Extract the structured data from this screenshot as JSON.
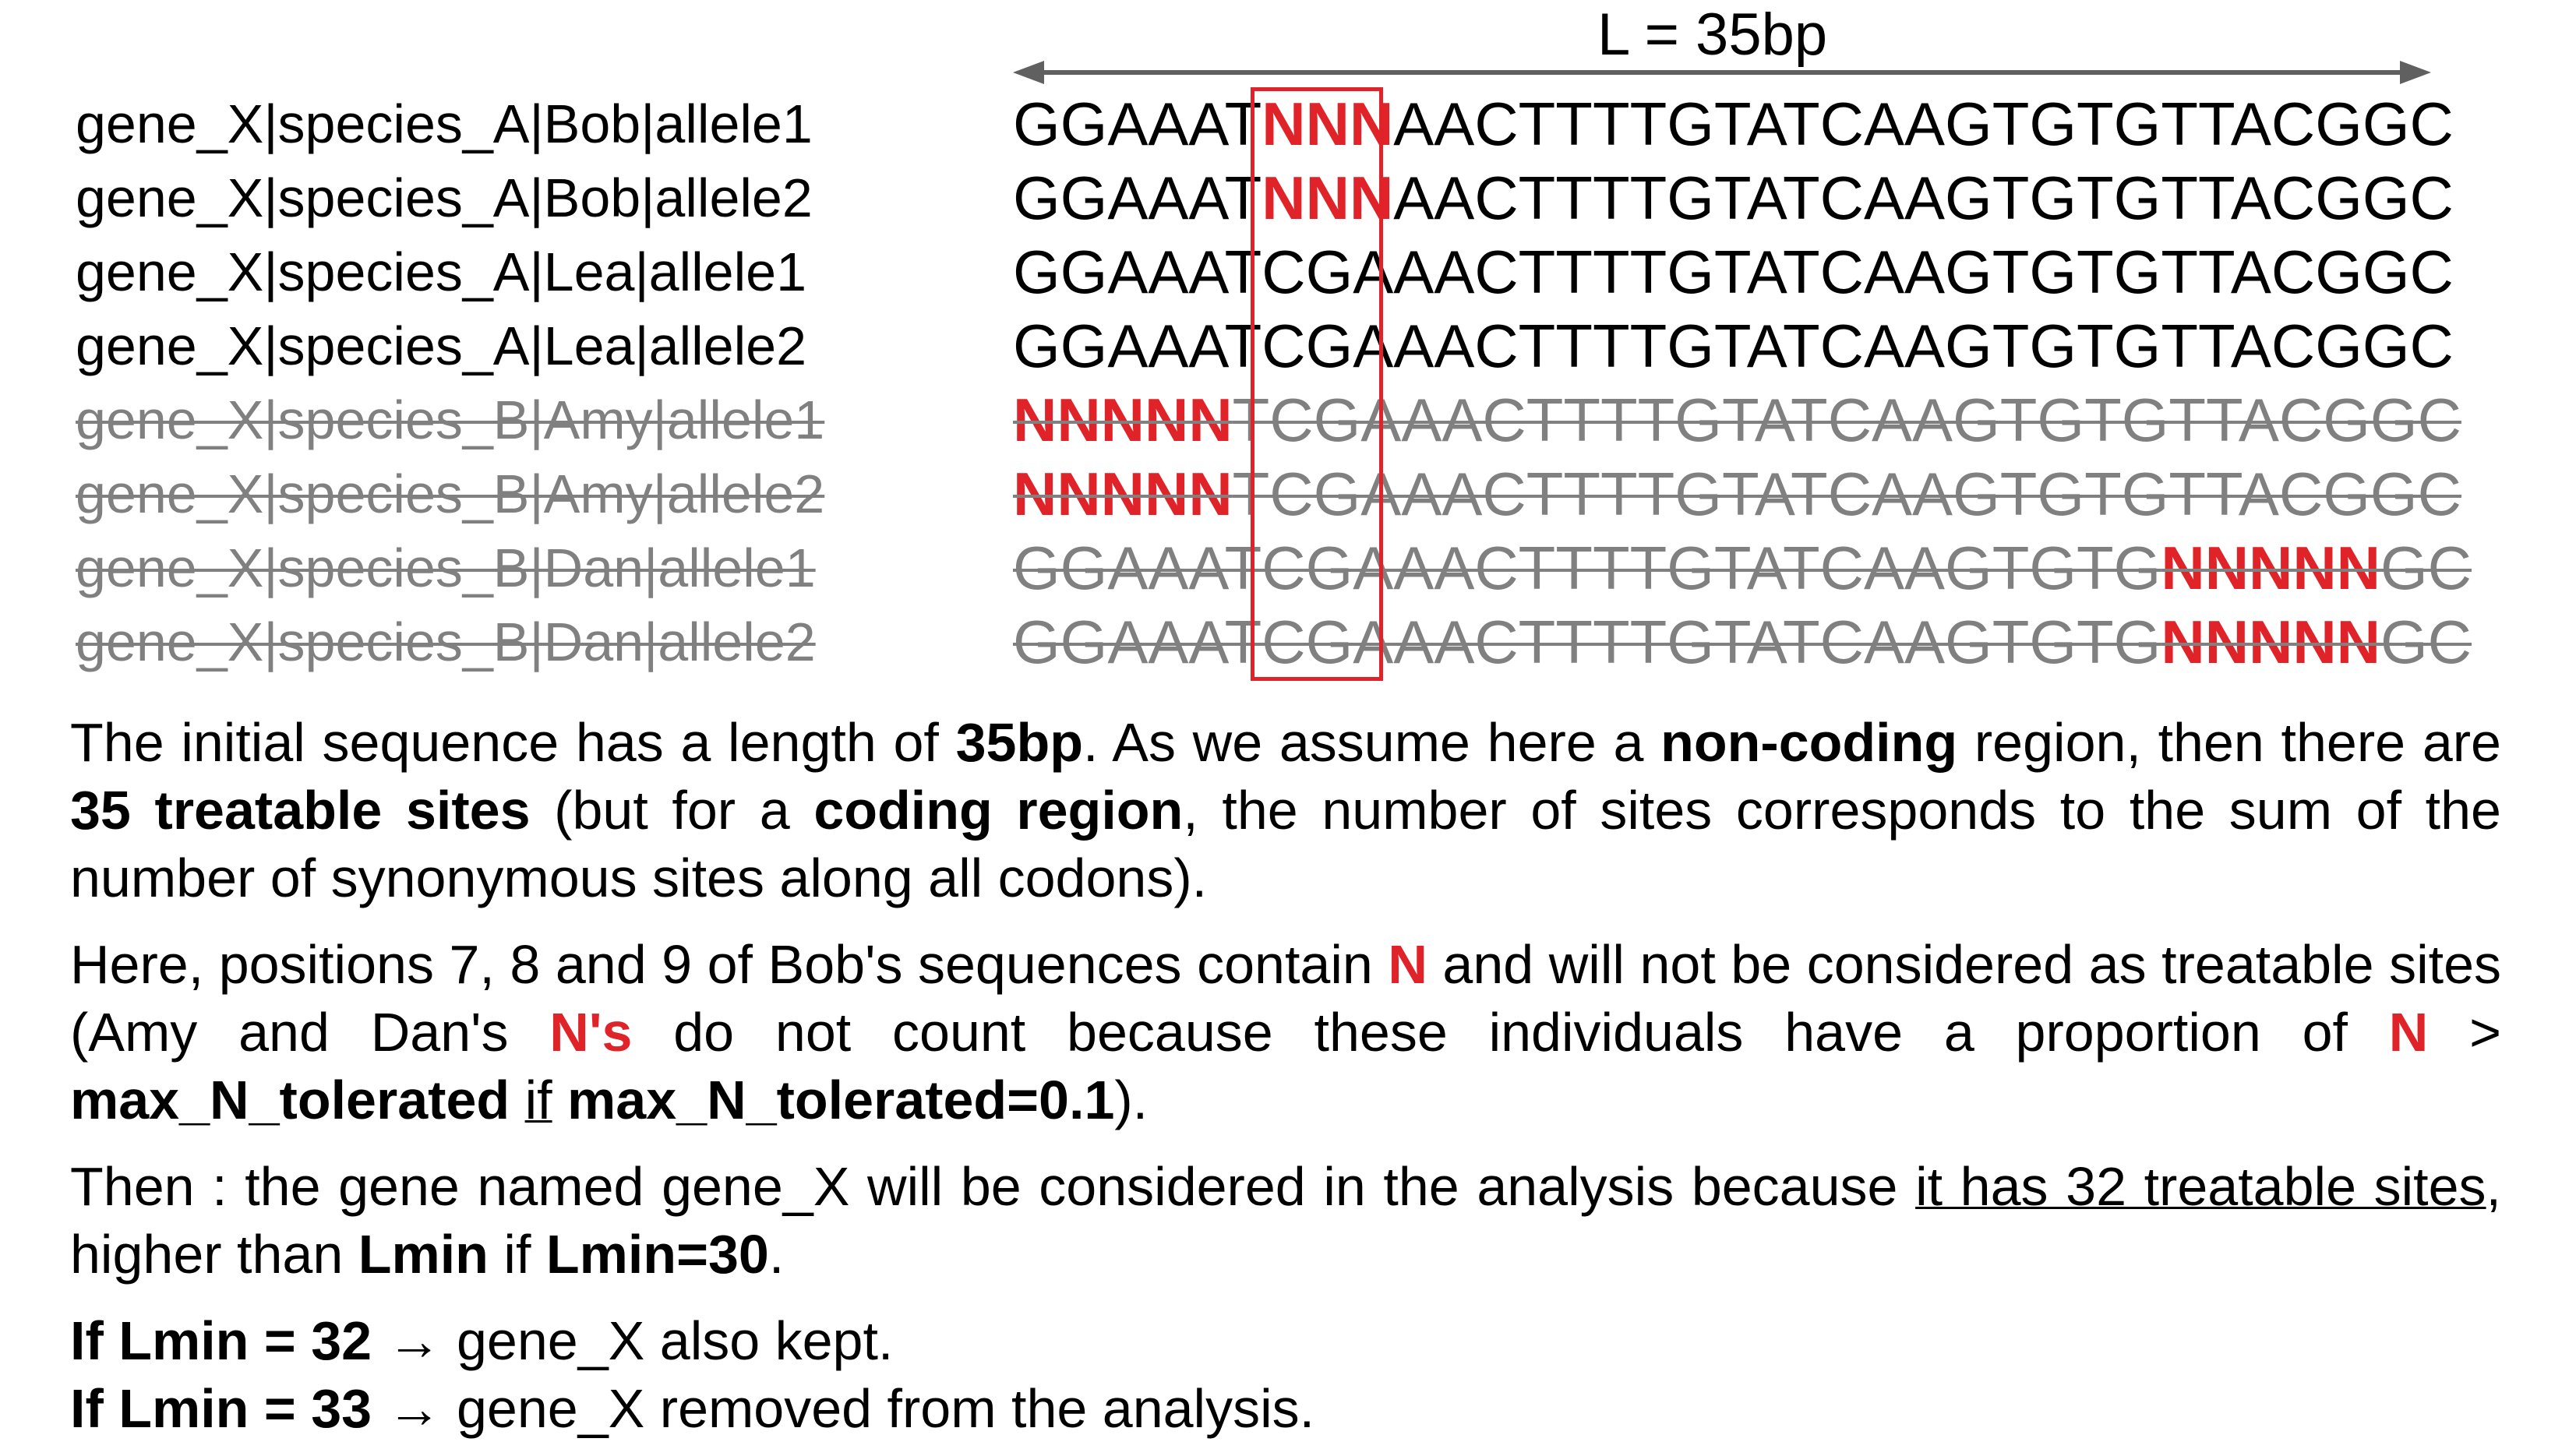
{
  "length_label": "L = 35bp",
  "gene_labels": [
    {
      "text": "gene_X|species_A|Bob|allele1",
      "excluded": false
    },
    {
      "text": "gene_X|species_A|Bob|allele2",
      "excluded": false
    },
    {
      "text": "gene_X|species_A|Lea|allele1",
      "excluded": false
    },
    {
      "text": "gene_X|species_A|Lea|allele2",
      "excluded": false
    },
    {
      "text": "gene_X|species_B|Amy|allele1",
      "excluded": true
    },
    {
      "text": "gene_X|species_B|Amy|allele2",
      "excluded": true
    },
    {
      "text": "gene_X|species_B|Dan|allele1",
      "excluded": true
    },
    {
      "text": "gene_X|species_B|Dan|allele2",
      "excluded": true
    }
  ],
  "sequences": [
    {
      "excluded": false,
      "segments": [
        {
          "text": "GGAAAT",
          "n": false
        },
        {
          "text": "NNN",
          "n": true
        },
        {
          "text": "AACTTTTGTATCAAGTGTGTTACGGC",
          "n": false
        }
      ]
    },
    {
      "excluded": false,
      "segments": [
        {
          "text": "GGAAAT",
          "n": false
        },
        {
          "text": "NNN",
          "n": true
        },
        {
          "text": "AACTTTTGTATCAAGTGTGTTACGGC",
          "n": false
        }
      ]
    },
    {
      "excluded": false,
      "segments": [
        {
          "text": "GGAAATCGAAACTTTTGTATCAAGTGTGTTACGGC",
          "n": false
        }
      ]
    },
    {
      "excluded": false,
      "segments": [
        {
          "text": "GGAAATCGAAACTTTTGTATCAAGTGTGTTACGGC",
          "n": false
        }
      ]
    },
    {
      "excluded": true,
      "segments": [
        {
          "text": "NNNNN",
          "n": true
        },
        {
          "text": "TCGAAACTTTTGTATCAAGTGTGTTACGGC",
          "n": false
        }
      ]
    },
    {
      "excluded": true,
      "segments": [
        {
          "text": "NNNNN",
          "n": true
        },
        {
          "text": "TCGAAACTTTTGTATCAAGTGTGTTACGGC",
          "n": false
        }
      ]
    },
    {
      "excluded": true,
      "segments": [
        {
          "text": "GGAAATCGAAACTTTTGTATCAAGTGTG",
          "n": false
        },
        {
          "text": "NNNNN",
          "n": true
        },
        {
          "text": "GC",
          "n": false
        }
      ]
    },
    {
      "excluded": true,
      "segments": [
        {
          "text": "GGAAATCGAAACTTTTGTATCAAGTGTG",
          "n": false
        },
        {
          "text": "NNNNN",
          "n": true
        },
        {
          "text": "GC",
          "n": false
        }
      ]
    }
  ],
  "paragraphs": [
    [
      {
        "text": "The initial sequence has a length of ",
        "style": "normal"
      },
      {
        "text": "35bp",
        "style": "bold"
      },
      {
        "text": ". As we assume here a ",
        "style": "normal"
      },
      {
        "text": "non-coding",
        "style": "bold"
      },
      {
        "text": " region, then there are ",
        "style": "normal"
      },
      {
        "text": "35 treatable sites",
        "style": "bold"
      },
      {
        "text": " (but for a ",
        "style": "normal"
      },
      {
        "text": "coding region",
        "style": "bold"
      },
      {
        "text": ", the number of sites corresponds to the sum of the number of synonymous sites along all codons).",
        "style": "normal"
      }
    ],
    [
      {
        "text": "Here, positions 7, 8 and 9 of Bob's sequences contain ",
        "style": "normal"
      },
      {
        "text": "N",
        "style": "red"
      },
      {
        "text": " and will not be considered as treatable sites (Amy and Dan's ",
        "style": "normal"
      },
      {
        "text": "N's",
        "style": "red"
      },
      {
        "text": " do not count because these individuals have a proportion of ",
        "style": "normal"
      },
      {
        "text": "N",
        "style": "red"
      },
      {
        "text": " > ",
        "style": "normal"
      },
      {
        "text": "max_N_tolerated",
        "style": "bold"
      },
      {
        "text": " ",
        "style": "normal"
      },
      {
        "text": "if",
        "style": "underline"
      },
      {
        "text": " ",
        "style": "normal"
      },
      {
        "text": "max_N_tolerated=0.1",
        "style": "bold"
      },
      {
        "text": ").",
        "style": "normal"
      }
    ],
    [
      {
        "text": "Then : the gene named gene_X will be considered in the analysis because ",
        "style": "normal"
      },
      {
        "text": "it has 32 treatable sites",
        "style": "underline"
      },
      {
        "text": ", higher than ",
        "style": "normal"
      },
      {
        "text": "Lmin",
        "style": "bold"
      },
      {
        "text": " if ",
        "style": "normal"
      },
      {
        "text": "Lmin=30",
        "style": "bold"
      },
      {
        "text": ".",
        "style": "normal"
      }
    ]
  ],
  "rules": [
    {
      "condition": "If Lmin = 32",
      "arrow": "→",
      "outcome": "gene_X also kept."
    },
    {
      "condition": "If Lmin = 33",
      "arrow": "→",
      "outcome": "gene_X removed from the analysis."
    }
  ],
  "colors": {
    "highlight": "#e02229",
    "excluded_text": "#808080",
    "arrow": "#606060"
  }
}
